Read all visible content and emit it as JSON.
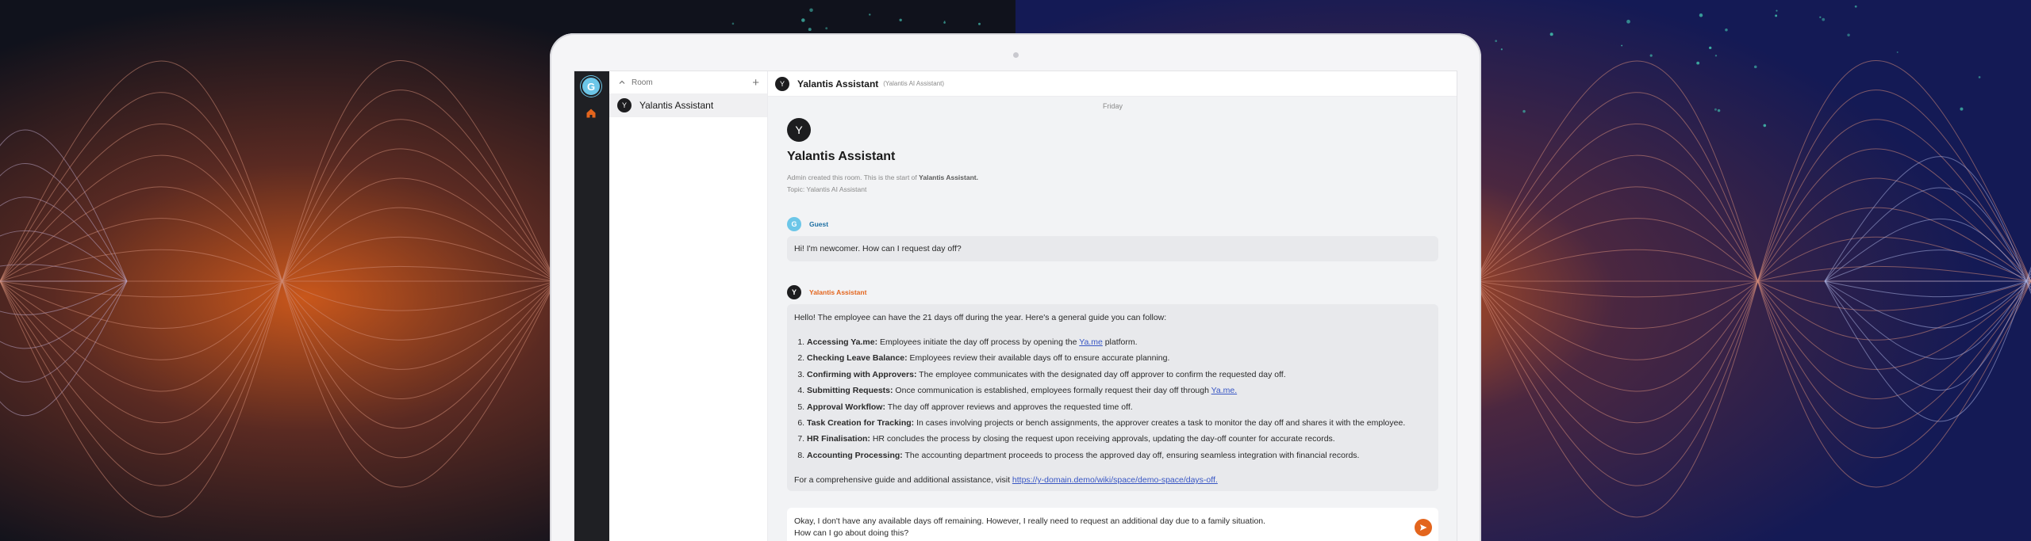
{
  "colors": {
    "accent_orange": "#e3651d",
    "guest_blue": "#6cc6e8",
    "link": "#3856c4",
    "rail_dark": "#1f2024"
  },
  "rail": {
    "user_initial": "G",
    "icons": [
      "home-icon"
    ]
  },
  "roomlist": {
    "section_label": "Room",
    "add_icon": "+",
    "rooms": [
      {
        "initial": "Y",
        "name": "Yalantis Assistant",
        "selected": true
      }
    ]
  },
  "header": {
    "initial": "Y",
    "room_name": "Yalantis Assistant",
    "topic": "(Yalantis AI Assistant)"
  },
  "timeline": {
    "day_separator": "Friday",
    "intro": {
      "initial": "Y",
      "title": "Yalantis Assistant",
      "created_prefix": "Admin created this room. This is the start of",
      "created_room": "Yalantis Assistant.",
      "topic_line": "Topic: Yalantis AI Assistant"
    },
    "guest_message": {
      "initial": "G",
      "sender": "Guest",
      "text": "Hi! I'm newcomer. How can I request day off?"
    },
    "assistant_message": {
      "initial": "Y",
      "sender": "Yalantis Assistant",
      "intro": "Hello! The employee can have the 21 days off during the year. Here's a general guide you can follow:",
      "steps": [
        {
          "title": "Accessing Ya.me:",
          "before": " Employees initiate the day off process by opening the ",
          "link": "Ya.me",
          "after": " platform."
        },
        {
          "title": "Checking Leave Balance:",
          "before": " Employees review their available days off to ensure accurate planning.",
          "link": "",
          "after": ""
        },
        {
          "title": "Confirming with Approvers:",
          "before": " The employee communicates with the designated day off approver to confirm the requested day off.",
          "link": "",
          "after": ""
        },
        {
          "title": "Submitting Requests:",
          "before": " Once communication is established, employees formally request their day off through ",
          "link": "Ya.me.",
          "after": ""
        },
        {
          "title": "Approval Workflow:",
          "before": " The day off approver reviews and approves the requested time off.",
          "link": "",
          "after": ""
        },
        {
          "title": "Task Creation for Tracking:",
          "before": " In cases involving projects or bench assignments, the approver creates a task to monitor the day off and shares it with the employee.",
          "link": "",
          "after": ""
        },
        {
          "title": "HR Finalisation:",
          "before": " HR concludes the process by closing the request upon receiving approvals, updating the day-off counter for accurate records.",
          "link": "",
          "after": ""
        },
        {
          "title": "Accounting Processing:",
          "before": " The accounting department proceeds to process the approved day off, ensuring seamless integration with financial records.",
          "link": "",
          "after": ""
        }
      ],
      "outro_prefix": "For a comprehensive guide and additional assistance, visit ",
      "outro_link": "https://y-domain.demo/wiki/space/demo-space/days-off."
    }
  },
  "composer": {
    "line1": "Okay, I don't have any available days off remaining. However, I really need to request an additional day due to a family situation.",
    "line2": "How can I go about doing this?",
    "send_icon": "send-icon"
  }
}
